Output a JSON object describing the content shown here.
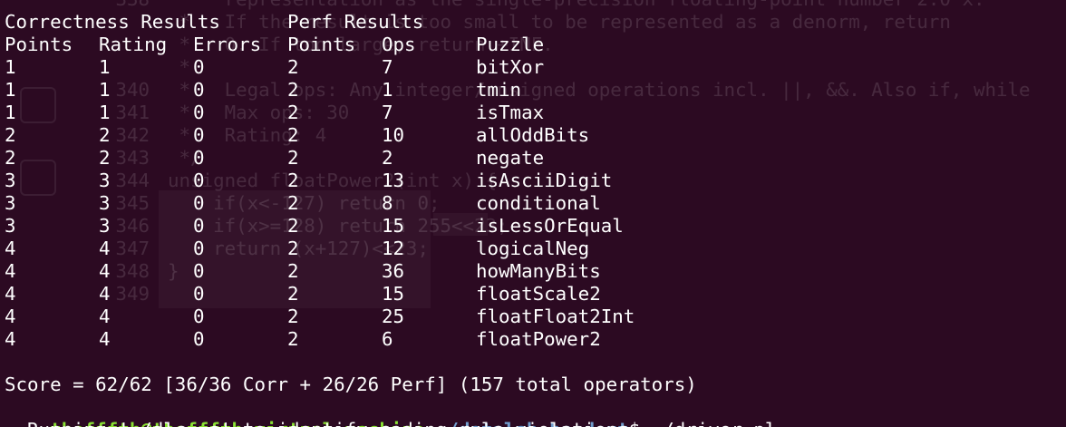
{
  "header": {
    "row1": [
      "Correctness Results",
      "Perf Results"
    ],
    "row2": [
      "Points",
      "Rating",
      "Errors",
      "Points",
      "Ops",
      "Puzzle"
    ]
  },
  "rows": [
    [
      "1",
      "1",
      "0",
      "2",
      "7",
      "bitXor"
    ],
    [
      "1",
      "1",
      "0",
      "2",
      "1",
      "tmin"
    ],
    [
      "1",
      "1",
      "0",
      "2",
      "7",
      "isTmax"
    ],
    [
      "2",
      "2",
      "0",
      "2",
      "10",
      "allOddBits"
    ],
    [
      "2",
      "2",
      "0",
      "2",
      "2",
      "negate"
    ],
    [
      "3",
      "3",
      "0",
      "2",
      "13",
      "isAsciiDigit"
    ],
    [
      "3",
      "3",
      "0",
      "2",
      "8",
      "conditional"
    ],
    [
      "3",
      "3",
      "0",
      "2",
      "15",
      "isLessOrEqual"
    ],
    [
      "4",
      "4",
      "0",
      "2",
      "12",
      "logicalNeg"
    ],
    [
      "4",
      "4",
      "0",
      "2",
      "36",
      "howManyBits"
    ],
    [
      "4",
      "4",
      "0",
      "2",
      "15",
      "floatScale2"
    ],
    [
      "4",
      "4",
      "0",
      "2",
      "25",
      "floatFloat2Int"
    ],
    [
      "4",
      "4",
      "0",
      "2",
      "6",
      "floatPower2"
    ]
  ],
  "score_line": "Score = 62/62 [36/36 Corr + 26/26 Perf] (157 total operators)",
  "prompt": {
    "user_host": "thefffth@thefffth-virtual-machine",
    "colon": ":",
    "path": "~/datalab-handout",
    "dollar": "$ ",
    "command": "./driver.pl"
  },
  "next_line_partial": "  Running './dlc -e' to identify coding rule violations.",
  "ghost_text": [
    {
      "n": "338",
      "t": " *   representation as the single-precision floating-point number 2.0^x."
    },
    {
      "n": "",
      "t": " *   If the result is too small to be represented as a denorm, return"
    },
    {
      "n": "",
      "t": " *   0. If too large, return +INF."
    },
    {
      "n": "",
      "t": " * "
    },
    {
      "n": "340",
      "t": " *   Legal ops: Any integer/unsigned operations incl. ||, &&. Also if, while"
    },
    {
      "n": "341",
      "t": " *   Max ops: 30"
    },
    {
      "n": "342",
      "t": " *   Rating: 4"
    },
    {
      "n": "343",
      "t": " */"
    },
    {
      "n": "344",
      "t": "unsigned floatPower2(int x) {"
    },
    {
      "n": "345",
      "t": "    if(x<-127) return 0;"
    },
    {
      "n": "346",
      "t": "    if(x>=128) return 255<<23;"
    },
    {
      "n": "347",
      "t": "    return (x+127)<<23;"
    },
    {
      "n": "348",
      "t": "}"
    },
    {
      "n": "349",
      "t": ""
    }
  ]
}
